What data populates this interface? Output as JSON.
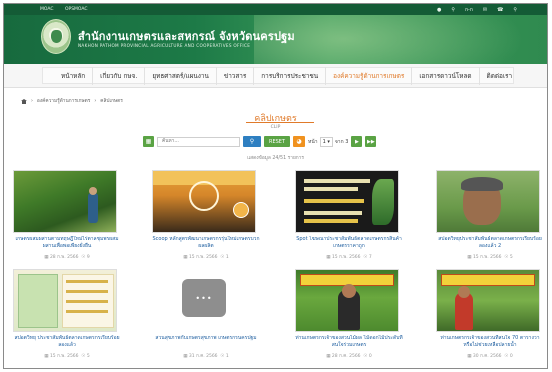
{
  "topbar": {
    "links": [
      "MOAC",
      "OPSMOAC"
    ],
    "icons": [
      "user-icon",
      "search-icon",
      "text-size-icon",
      "mail-icon",
      "phone-icon",
      "map-pin-icon"
    ],
    "text_size_label": "ก-ก"
  },
  "header": {
    "title": "สำนักงานเกษตรและสหกรณ์ จังหวัดนครปฐม",
    "subtitle": "NAKHON PATHOM PROVINCIAL AGRICULTURE AND COOPERATIVES OFFICE"
  },
  "nav": {
    "items": [
      {
        "label": "หน้าหลัก",
        "active": false
      },
      {
        "label": "เกี่ยวกับ กษจ.",
        "active": false
      },
      {
        "label": "ยุทธศาสตร์/แผนงาน",
        "active": false
      },
      {
        "label": "ข่าวสาร",
        "active": false
      },
      {
        "label": "การบริการประชาชน",
        "active": false
      },
      {
        "label": "องค์ความรู้ด้านการเกษตร",
        "active": true
      },
      {
        "label": "เอกสารดาวน์โหลด",
        "active": false
      },
      {
        "label": "ติดต่อเรา",
        "active": false
      }
    ]
  },
  "breadcrumb": {
    "parent": "องค์ความรู้ด้านการเกษตร",
    "current": "คลิปเกษตร"
  },
  "page": {
    "title": "คลิปเกษตร",
    "subtitle": "CLIP",
    "count_text": "แสดงข้อมูล 24/51 รายการ"
  },
  "toolbar": {
    "search_placeholder": "ค้นหา...",
    "reset_label": "RESET",
    "page_prefix": "หน้า",
    "page_value": "1",
    "page_of": "จาก 3"
  },
  "colors": {
    "brand_green": "#145b36",
    "accent_orange": "#e07a2a",
    "link_blue": "#1f5fa0"
  },
  "cards": [
    {
      "caption": "เกษตรผสมผสานตามทฤษฎีใหม่ไร่ตาลชุมพรผสมผสานเพื่อพอเพียงยั่งยืน",
      "date": "28 ก.พ. 2566",
      "views": "9"
    },
    {
      "caption": "Scoop หลักสูตรพัฒนาเกษตรกรรุ่นใหม่เกษตรบวกผลผลิต",
      "date": "15 ก.พ. 2566",
      "views": "1"
    },
    {
      "caption": "Spot โฆษณาประชาสัมพันธ์ตลาดเกษตรกรสินค้าเกษตรราคาถูก",
      "date": "15 ก.พ. 2566",
      "views": "7"
    },
    {
      "caption": "สปอตวิทยุประชาสัมพันธ์ตลาดเกษตรกรเรียบร้อยลองแล้ว 2",
      "date": "15 ก.พ. 2566",
      "views": "5"
    },
    {
      "caption": "สปอตวิทยุ ประชาสัมพันธ์ตลาดเกษตรกรเรียบร้อยลองแล้ว",
      "date": "15 ก.พ. 2566",
      "views": "5"
    },
    {
      "caption": "สวนสุขภาพกับเกษตรสุขภาพ เกษตรกรนครปฐม",
      "date": "31 ก.ค. 2566",
      "views": "1"
    },
    {
      "caption": "ท่านเกษตรกรเจ้าของสวนไม้ผล ไม้ดอกไม้ประดับที่สนใจร่วมเกษตร",
      "date": "28 ก.ค. 2566",
      "views": "0"
    },
    {
      "caption": "ท่านเกษตรกรเจ้าของสวนที่สนใจ 70 ตารางวาหรือไม่ช่วยเหลือปลายน้ำ",
      "date": "30 ก.ค. 2566",
      "views": "0"
    }
  ]
}
